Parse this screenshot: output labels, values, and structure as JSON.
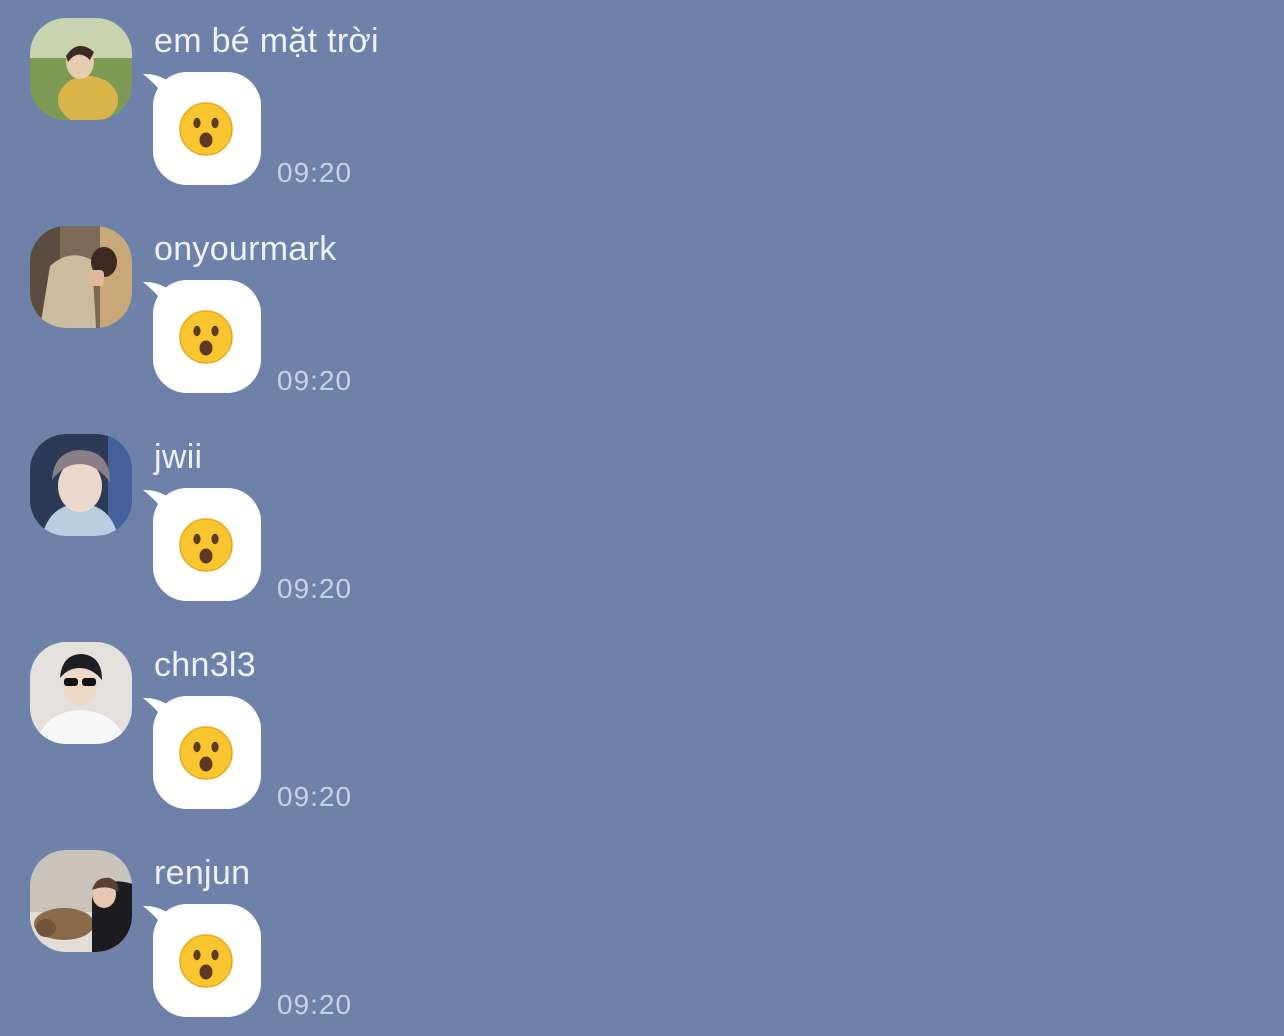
{
  "colors": {
    "background": "#6e82a9",
    "bubble": "#ffffff",
    "sender_text": "#eef1f7",
    "time_text": "#c9d2e3",
    "emoji_face": "#f8c531"
  },
  "messages": [
    {
      "sender": "em bé mặt trời",
      "avatar_icon": "avatar-photo",
      "content_icon": "hushed-face-emoji",
      "time": "09:20"
    },
    {
      "sender": "onyourmark",
      "avatar_icon": "avatar-photo",
      "content_icon": "hushed-face-emoji",
      "time": "09:20"
    },
    {
      "sender": "jwii",
      "avatar_icon": "avatar-photo",
      "content_icon": "hushed-face-emoji",
      "time": "09:20"
    },
    {
      "sender": "chn3l3",
      "avatar_icon": "avatar-photo",
      "content_icon": "hushed-face-emoji",
      "time": "09:20"
    },
    {
      "sender": "renjun",
      "avatar_icon": "avatar-photo",
      "content_icon": "hushed-face-emoji",
      "time": "09:20"
    }
  ]
}
